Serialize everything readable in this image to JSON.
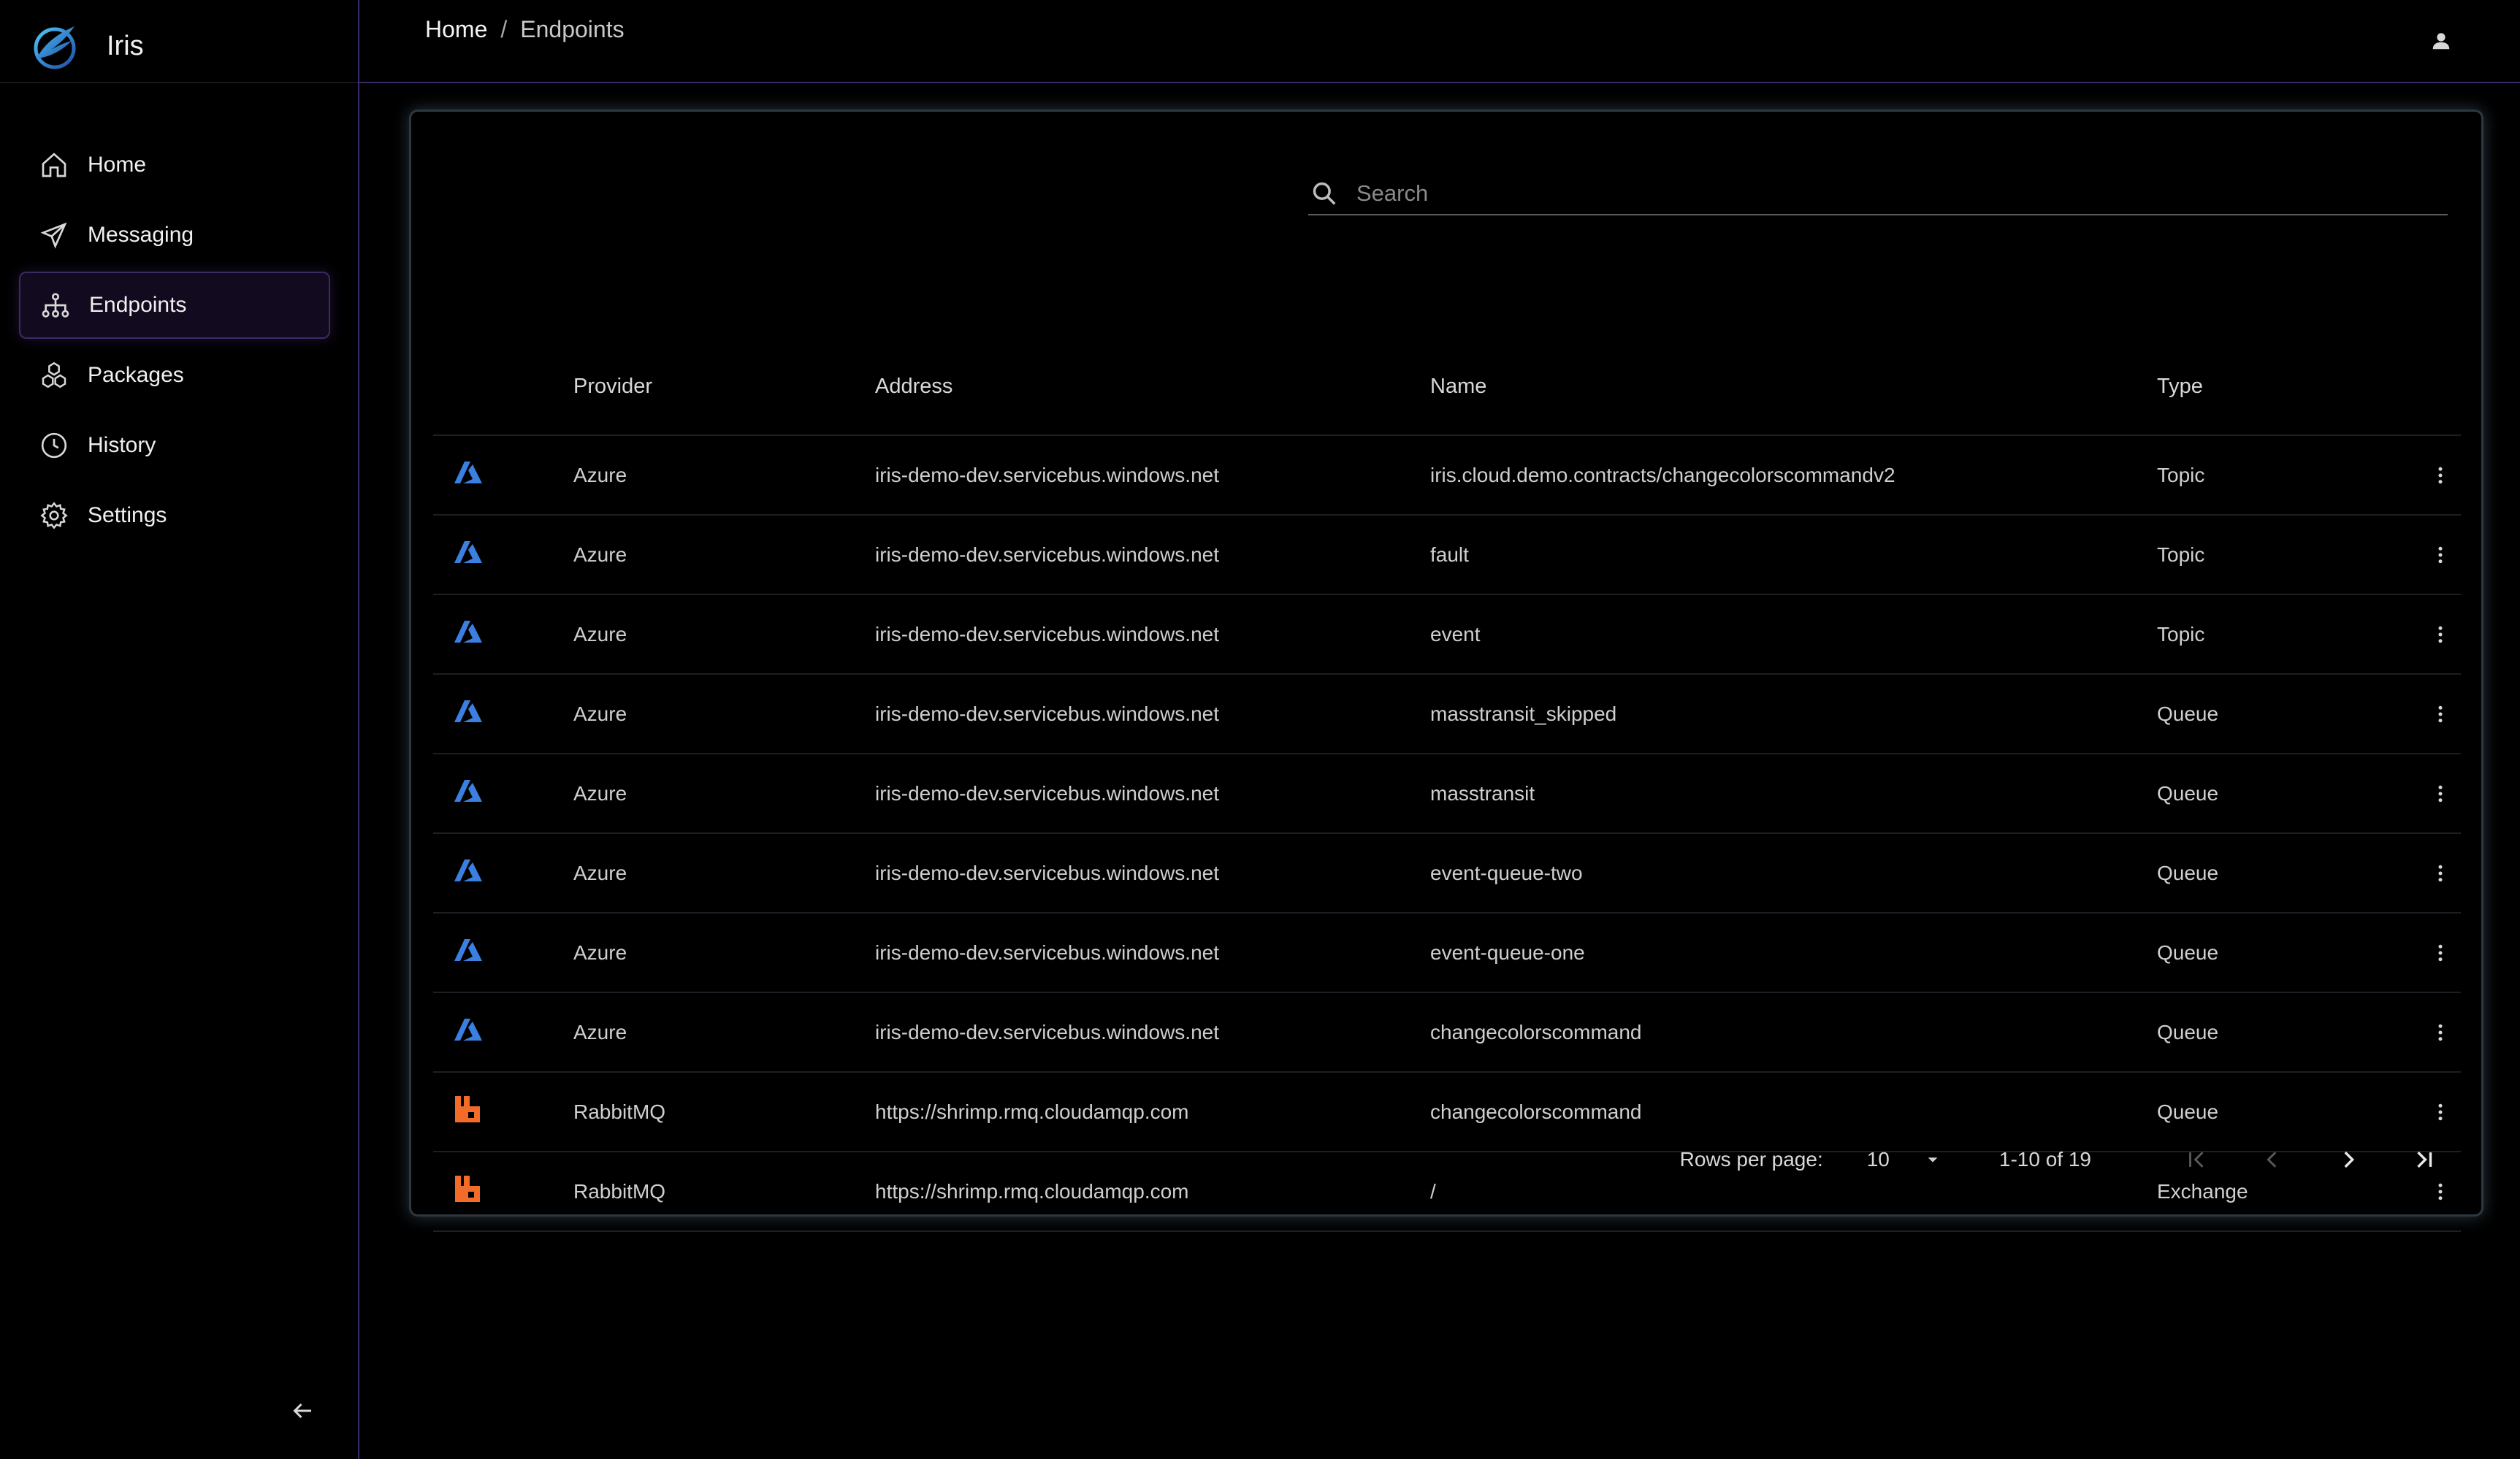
{
  "app": {
    "name": "Iris"
  },
  "sidebar": {
    "items": [
      {
        "label": "Home",
        "icon": "home-icon"
      },
      {
        "label": "Messaging",
        "icon": "send-icon"
      },
      {
        "label": "Endpoints",
        "icon": "network-icon",
        "active": true
      },
      {
        "label": "Packages",
        "icon": "packages-icon"
      },
      {
        "label": "History",
        "icon": "clock-icon"
      },
      {
        "label": "Settings",
        "icon": "gear-icon"
      }
    ]
  },
  "header": {
    "breadcrumb": {
      "home": "Home",
      "separator": "/",
      "current": "Endpoints"
    }
  },
  "search": {
    "placeholder": "Search",
    "value": ""
  },
  "table": {
    "columns": [
      "Provider",
      "Address",
      "Name",
      "Type"
    ],
    "rows": [
      {
        "provider": "Azure",
        "icon": "azure-icon",
        "address": "iris-demo-dev.servicebus.windows.net",
        "name": "iris.cloud.demo.contracts/changecolorscommandv2",
        "type": "Topic"
      },
      {
        "provider": "Azure",
        "icon": "azure-icon",
        "address": "iris-demo-dev.servicebus.windows.net",
        "name": "fault",
        "type": "Topic"
      },
      {
        "provider": "Azure",
        "icon": "azure-icon",
        "address": "iris-demo-dev.servicebus.windows.net",
        "name": "event",
        "type": "Topic"
      },
      {
        "provider": "Azure",
        "icon": "azure-icon",
        "address": "iris-demo-dev.servicebus.windows.net",
        "name": "masstransit_skipped",
        "type": "Queue"
      },
      {
        "provider": "Azure",
        "icon": "azure-icon",
        "address": "iris-demo-dev.servicebus.windows.net",
        "name": "masstransit",
        "type": "Queue"
      },
      {
        "provider": "Azure",
        "icon": "azure-icon",
        "address": "iris-demo-dev.servicebus.windows.net",
        "name": "event-queue-two",
        "type": "Queue"
      },
      {
        "provider": "Azure",
        "icon": "azure-icon",
        "address": "iris-demo-dev.servicebus.windows.net",
        "name": "event-queue-one",
        "type": "Queue"
      },
      {
        "provider": "Azure",
        "icon": "azure-icon",
        "address": "iris-demo-dev.servicebus.windows.net",
        "name": "changecolorscommand",
        "type": "Queue"
      },
      {
        "provider": "RabbitMQ",
        "icon": "rabbitmq-icon",
        "address": "https://shrimp.rmq.cloudamqp.com",
        "name": "changecolorscommand",
        "type": "Queue"
      },
      {
        "provider": "RabbitMQ",
        "icon": "rabbitmq-icon",
        "address": "https://shrimp.rmq.cloudamqp.com",
        "name": "/",
        "type": "Exchange"
      }
    ]
  },
  "pagination": {
    "rows_per_page_label": "Rows per page:",
    "rows_per_page": "10",
    "range": "1-10 of 19"
  },
  "colors": {
    "azure": "#3b7fe0",
    "rabbitmq": "#f36b28",
    "accent": "#3c2a66",
    "background": "#000000"
  }
}
